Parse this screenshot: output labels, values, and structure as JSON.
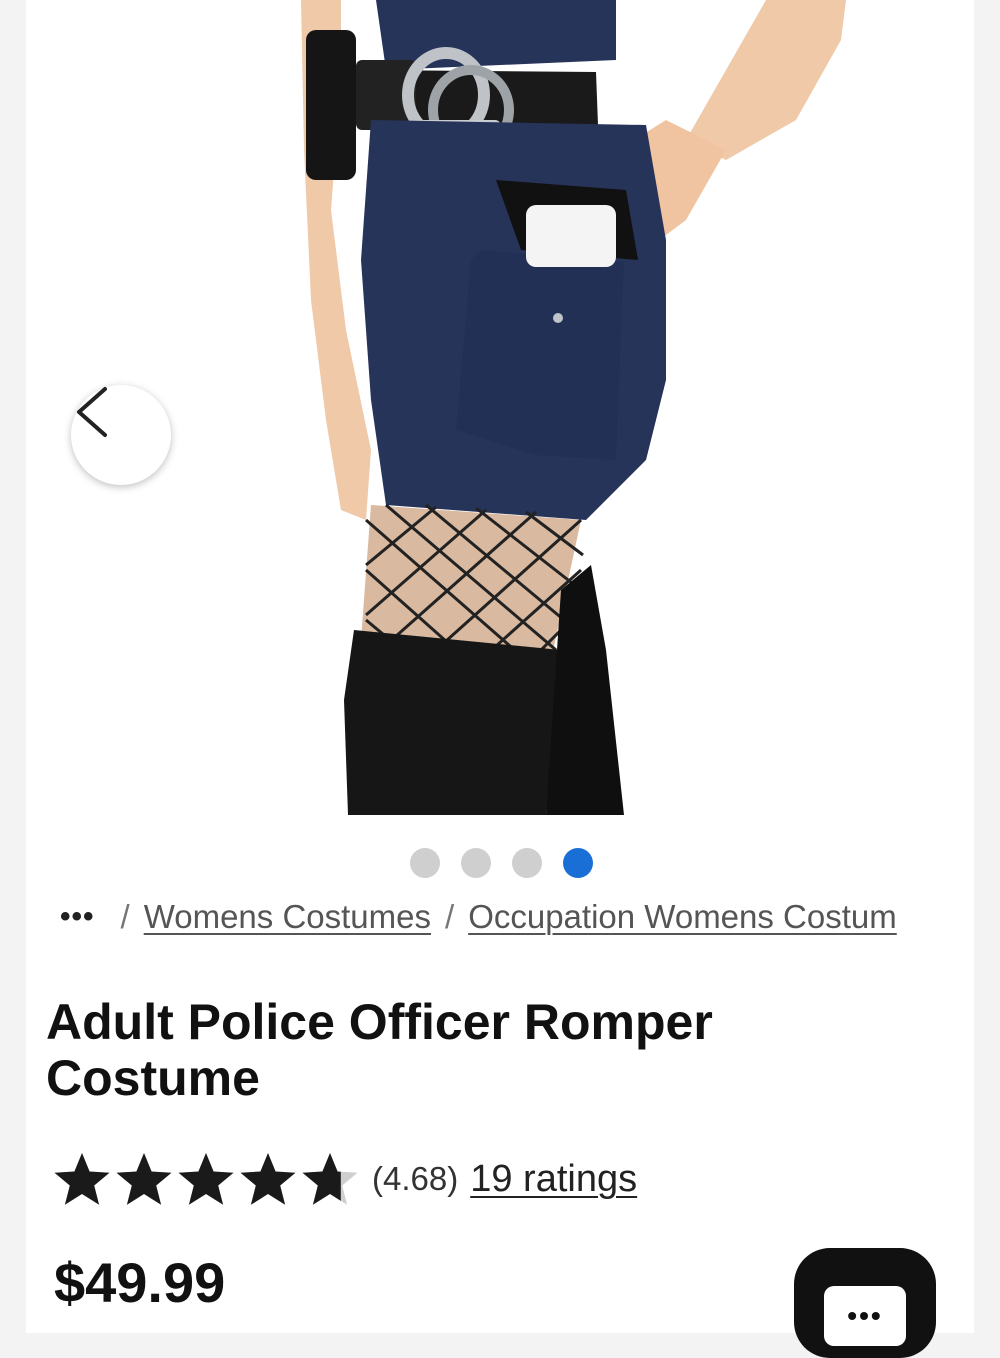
{
  "carousel": {
    "image_alt": "Adult Police Officer Romper Costume product photo",
    "prev_label": "Previous image",
    "total_slides": 4,
    "active_slide": 4
  },
  "breadcrumb": {
    "more": "•••",
    "items": [
      "Womens Costumes",
      "Occupation Womens Costum"
    ]
  },
  "product": {
    "title": "Adult Police Officer Romper Costume",
    "rating_value": "(4.68)",
    "rating_stars": 4.68,
    "rating_count": "19 ratings",
    "price": "$49.99"
  },
  "chat": {
    "label": "•••"
  },
  "colors": {
    "accent": "#1a6fd6",
    "navy": "#27345a"
  }
}
